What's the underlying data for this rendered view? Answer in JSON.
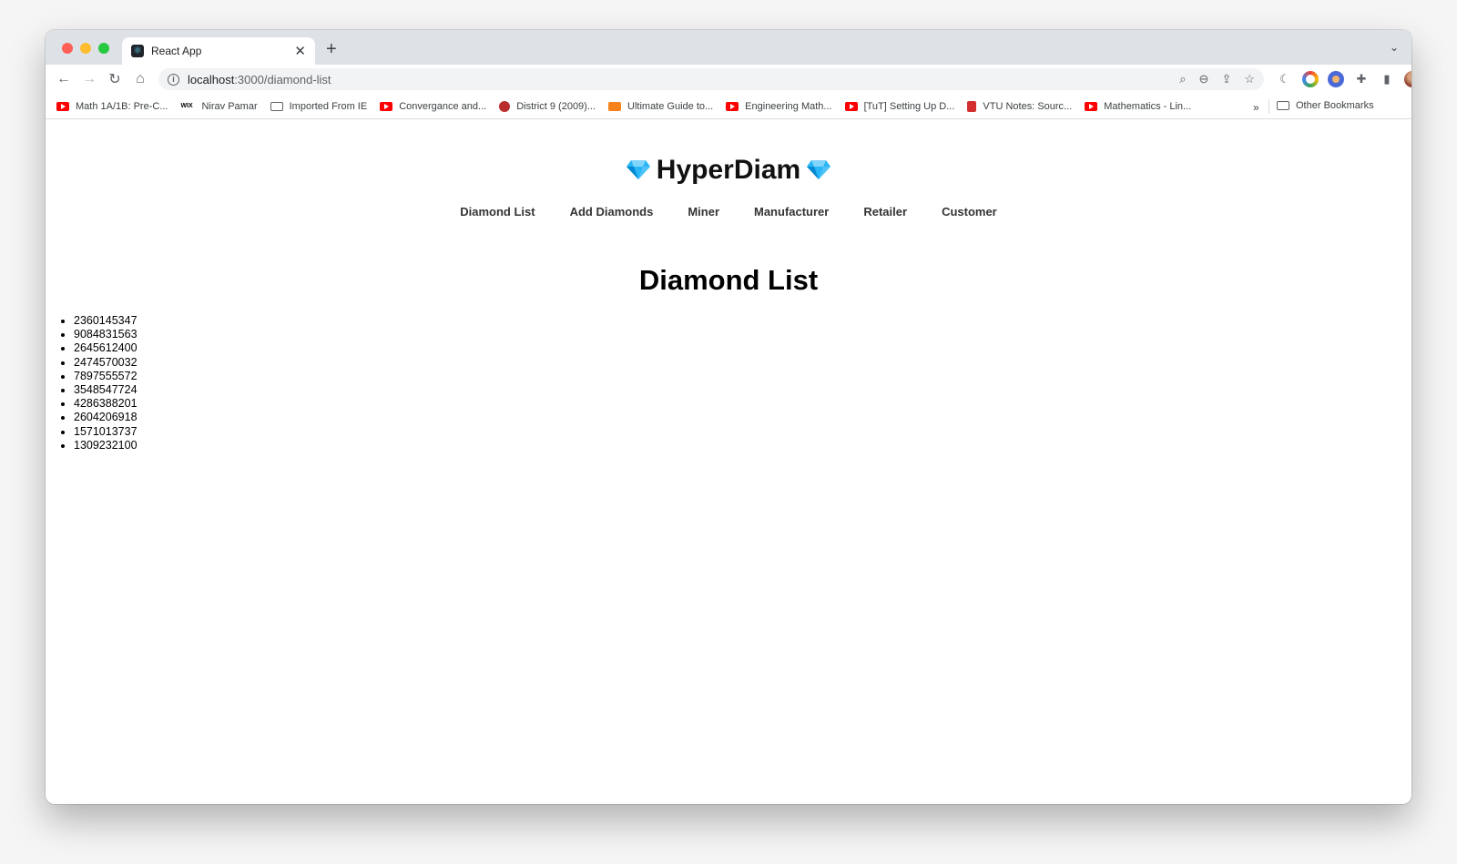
{
  "browser": {
    "tab_title": "React App",
    "url_host": "localhost",
    "url_path": ":3000/diamond-list",
    "bookmarks": [
      {
        "label": "Math 1A/1B: Pre-C...",
        "icon": "youtube-icon"
      },
      {
        "label": "Nirav Pamar",
        "icon": "wix-icon"
      },
      {
        "label": "Imported From IE",
        "icon": "folder-icon"
      },
      {
        "label": "Convergance and...",
        "icon": "youtube-icon"
      },
      {
        "label": "District 9 (2009)...",
        "icon": "district9-icon"
      },
      {
        "label": "Ultimate Guide to...",
        "icon": "ultimate-guide-icon"
      },
      {
        "label": "Engineering Math...",
        "icon": "youtube-icon"
      },
      {
        "label": "[TuT] Setting Up D...",
        "icon": "youtube-icon"
      },
      {
        "label": "VTU Notes: Sourc...",
        "icon": "vtu-icon"
      },
      {
        "label": "Mathematics - Lin...",
        "icon": "youtube-icon"
      }
    ],
    "bookmarks_more": "»",
    "other_bookmarks": "Other Bookmarks"
  },
  "app": {
    "brand": "HyperDiam",
    "nav": [
      "Diamond List",
      "Add Diamonds",
      "Miner",
      "Manufacturer",
      "Retailer",
      "Customer"
    ],
    "heading": "Diamond List",
    "diamonds": [
      "2360145347",
      "9084831563",
      "2645612400",
      "2474570032",
      "7897555572",
      "3548547724",
      "4286388201",
      "2604206918",
      "1571013737",
      "1309232100"
    ]
  },
  "colors": {
    "gem": "#29b6f6",
    "youtube": "#ff0000"
  }
}
